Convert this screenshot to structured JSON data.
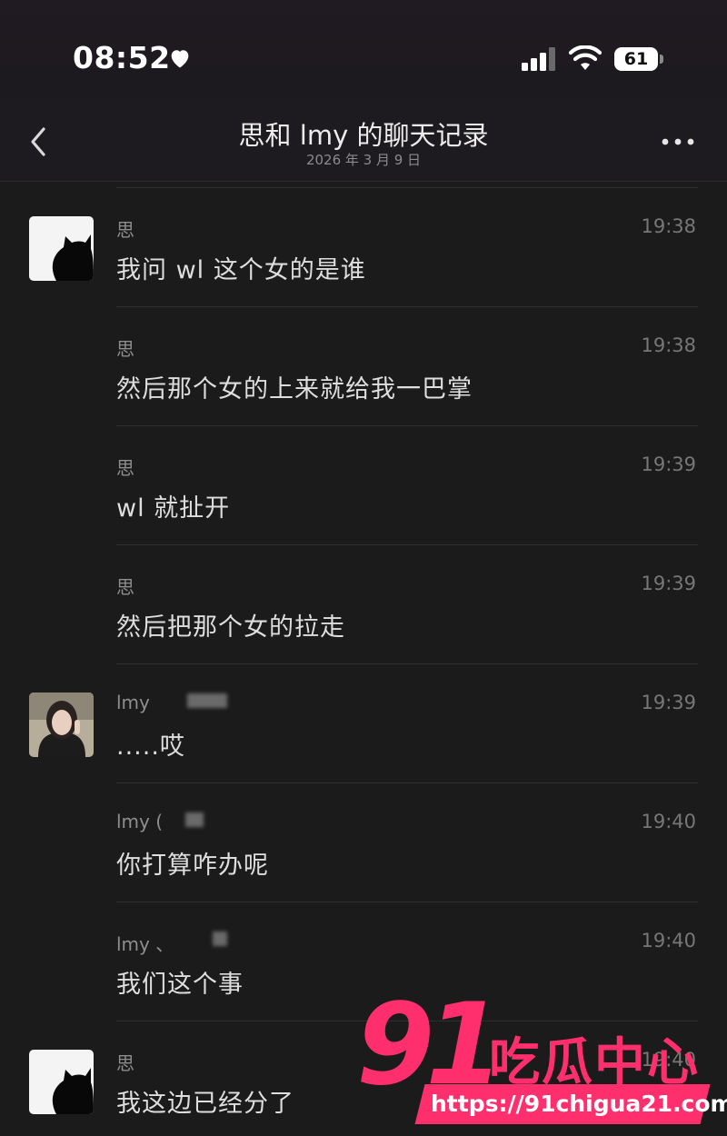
{
  "status_bar": {
    "time": "08:52",
    "battery": "61"
  },
  "header": {
    "title": "思和 lmy 的聊天记录",
    "subtitle": "2026 年 3 月 9 日"
  },
  "messages": [
    {
      "sender": "思",
      "time": "19:38",
      "text": "我问 wl 这个女的是谁",
      "avatar": "black-cat"
    },
    {
      "sender": "思",
      "time": "19:38",
      "text": "然后那个女的上来就给我一巴掌",
      "avatar": ""
    },
    {
      "sender": "思",
      "time": "19:39",
      "text": "wl 就扯开",
      "avatar": ""
    },
    {
      "sender": "思",
      "time": "19:39",
      "text": "然后把那个女的拉走",
      "avatar": ""
    },
    {
      "sender": "lmy",
      "time": "19:39",
      "text": ".....哎",
      "avatar": "girl-photo"
    },
    {
      "sender": "lmy (",
      "time": "19:40",
      "text": "你打算咋办呢",
      "avatar": ""
    },
    {
      "sender": "lmy 、",
      "time": "19:40",
      "text": "我们这个事",
      "avatar": ""
    },
    {
      "sender": "思",
      "time": "19:40",
      "text": "我这边已经分了",
      "avatar": "black-cat"
    }
  ],
  "watermark": {
    "number": "91",
    "brand": "吃瓜中心",
    "url": "https://91chigua21.com"
  },
  "colors": {
    "background": "#1b1b1c",
    "watermark": "#ff2f6e"
  }
}
